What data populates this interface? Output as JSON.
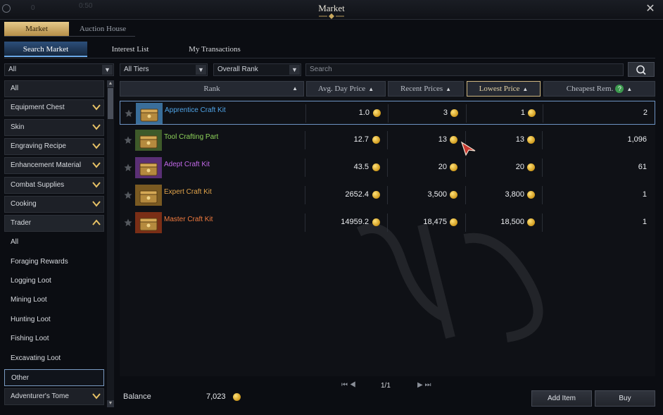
{
  "window": {
    "title": "Market",
    "close_glyph": "✕",
    "faint_text_1": "0",
    "faint_text_2": "0:50"
  },
  "top_tabs": [
    {
      "label": "Market",
      "active": true
    },
    {
      "label": "Auction House",
      "active": false
    }
  ],
  "sub_tabs": [
    {
      "label": "Search Market",
      "active": true
    },
    {
      "label": "Interest List",
      "active": false
    },
    {
      "label": "My Transactions",
      "active": false
    }
  ],
  "filters": {
    "category_select": "All",
    "tier_select": "All Tiers",
    "rank_select": "Overall Rank",
    "search_placeholder": "Search"
  },
  "sidebar": {
    "categories": [
      {
        "label": "All",
        "chevron": "none"
      },
      {
        "label": "Equipment Chest",
        "chevron": "down"
      },
      {
        "label": "Skin",
        "chevron": "down"
      },
      {
        "label": "Engraving Recipe",
        "chevron": "down"
      },
      {
        "label": "Enhancement Material",
        "chevron": "down"
      },
      {
        "label": "Combat Supplies",
        "chevron": "down"
      },
      {
        "label": "Cooking",
        "chevron": "down"
      },
      {
        "label": "Trader",
        "chevron": "up"
      }
    ],
    "trader_subcategories": [
      {
        "label": "All",
        "selected": false
      },
      {
        "label": "Foraging Rewards",
        "selected": false
      },
      {
        "label": "Logging Loot",
        "selected": false
      },
      {
        "label": "Mining Loot",
        "selected": false
      },
      {
        "label": "Hunting Loot",
        "selected": false
      },
      {
        "label": "Fishing Loot",
        "selected": false
      },
      {
        "label": "Excavating Loot",
        "selected": false
      },
      {
        "label": "Other",
        "selected": true
      }
    ],
    "after": [
      {
        "label": "Adventurer's Tome",
        "chevron": "down"
      }
    ]
  },
  "table": {
    "headers": {
      "rank": "Rank",
      "avg_day_price": "Avg. Day Price",
      "recent_prices": "Recent Prices",
      "lowest_price": "Lowest Price",
      "cheapest_rem": "Cheapest Rem."
    },
    "rows": [
      {
        "name": "Apprentice Craft Kit",
        "name_color": "#4fa3e6",
        "icon": "apprentice-craft-kit-icon",
        "icon_color": "#3a6e9a",
        "avg": "1.0",
        "recent": "3",
        "lowest": "1",
        "cheapest_rem": "2",
        "selected": true
      },
      {
        "name": "Tool Crafting Part",
        "name_color": "#8ed35a",
        "icon": "tool-crafting-part-icon",
        "icon_color": "#3e5a2a",
        "avg": "12.7",
        "recent": "13",
        "lowest": "13",
        "cheapest_rem": "1,096",
        "selected": false
      },
      {
        "name": "Adept Craft Kit",
        "name_color": "#c168e8",
        "icon": "adept-craft-kit-icon",
        "icon_color": "#5a2f75",
        "avg": "43.5",
        "recent": "20",
        "lowest": "20",
        "cheapest_rem": "61",
        "selected": false
      },
      {
        "name": "Expert Craft Kit",
        "name_color": "#e0a34a",
        "icon": "expert-craft-kit-icon",
        "icon_color": "#7a5a22",
        "avg": "2652.4",
        "recent": "3,500",
        "lowest": "3,800",
        "cheapest_rem": "1",
        "selected": false
      },
      {
        "name": "Master Craft Kit",
        "name_color": "#f07a3e",
        "icon": "master-craft-kit-icon",
        "icon_color": "#7a2e16",
        "avg": "14959.2",
        "recent": "18,475",
        "lowest": "18,500",
        "cheapest_rem": "1",
        "selected": false
      }
    ]
  },
  "pager": {
    "first_prev": "⏮ ◀",
    "text": "1/1",
    "next_last": "▶ ⏭"
  },
  "balance": {
    "label": "Balance",
    "value": "7,023"
  },
  "buttons": {
    "add_item": "Add Item",
    "buy": "Buy"
  },
  "accent_colors": {
    "gold": "#cdb580",
    "blue": "#6d93c2"
  }
}
